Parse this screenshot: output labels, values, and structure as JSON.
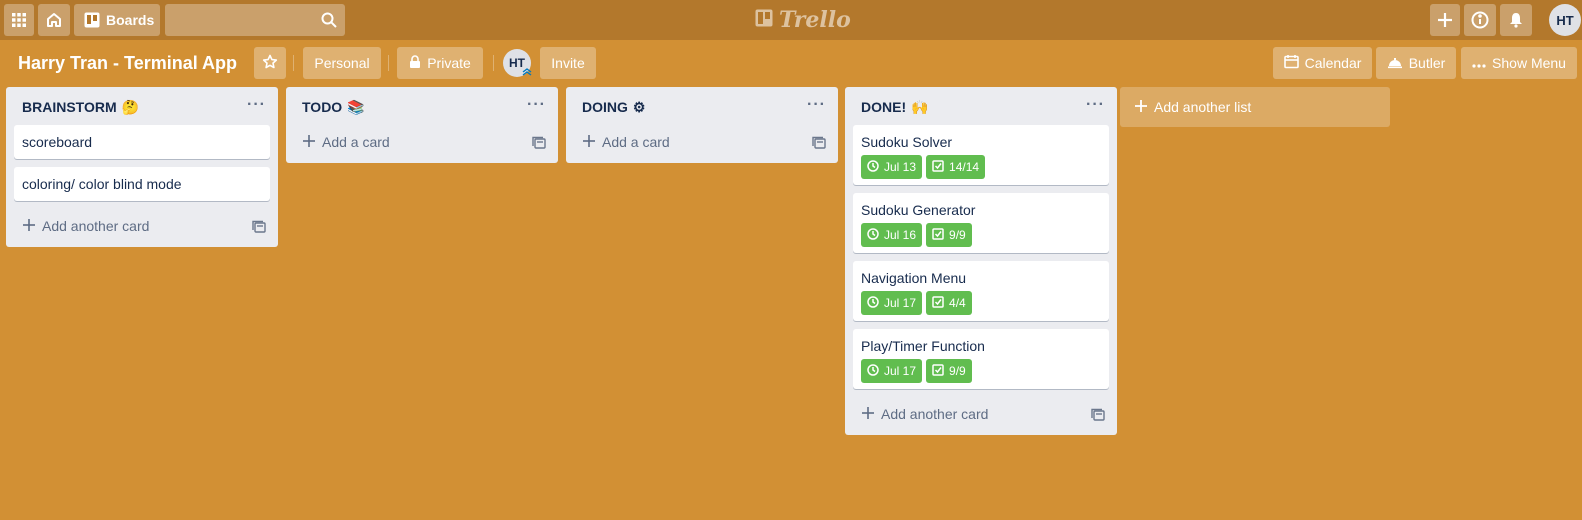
{
  "header": {
    "boards_label": "Boards",
    "search_placeholder": "",
    "logo_text": "Trello",
    "user_initials": "HT"
  },
  "board": {
    "title": "Harry Tran - Terminal App",
    "team_label": "Personal",
    "visibility_label": "Private",
    "member_initials": "HT",
    "invite_label": "Invite",
    "calendar_label": "Calendar",
    "butler_label": "Butler",
    "show_menu_label": "Show Menu"
  },
  "lists": [
    {
      "title": "BRAINSTORM",
      "emoji": "🤔",
      "cards": [
        {
          "title": "scoreboard"
        },
        {
          "title": "coloring/ color blind mode"
        }
      ],
      "add_label": "Add another card"
    },
    {
      "title": "TODO",
      "emoji": "📚",
      "cards": [],
      "add_label": "Add a card"
    },
    {
      "title": "DOING",
      "emoji": "⚙",
      "cards": [],
      "add_label": "Add a card"
    },
    {
      "title": "DONE!",
      "emoji": "🙌",
      "cards": [
        {
          "title": "Sudoku Solver",
          "due": "Jul 13",
          "checklist": "14/14"
        },
        {
          "title": "Sudoku Generator",
          "due": "Jul 16",
          "checklist": "9/9"
        },
        {
          "title": "Navigation Menu",
          "due": "Jul 17",
          "checklist": "4/4"
        },
        {
          "title": "Play/Timer Function",
          "due": "Jul 17",
          "checklist": "9/9"
        }
      ],
      "add_label": "Add another card"
    }
  ],
  "add_list_label": "Add another list",
  "colors": {
    "board_background": "#d29034",
    "header_background": "#b3782c",
    "list_background": "#ebecf0",
    "badge_complete": "#61bd4f"
  }
}
